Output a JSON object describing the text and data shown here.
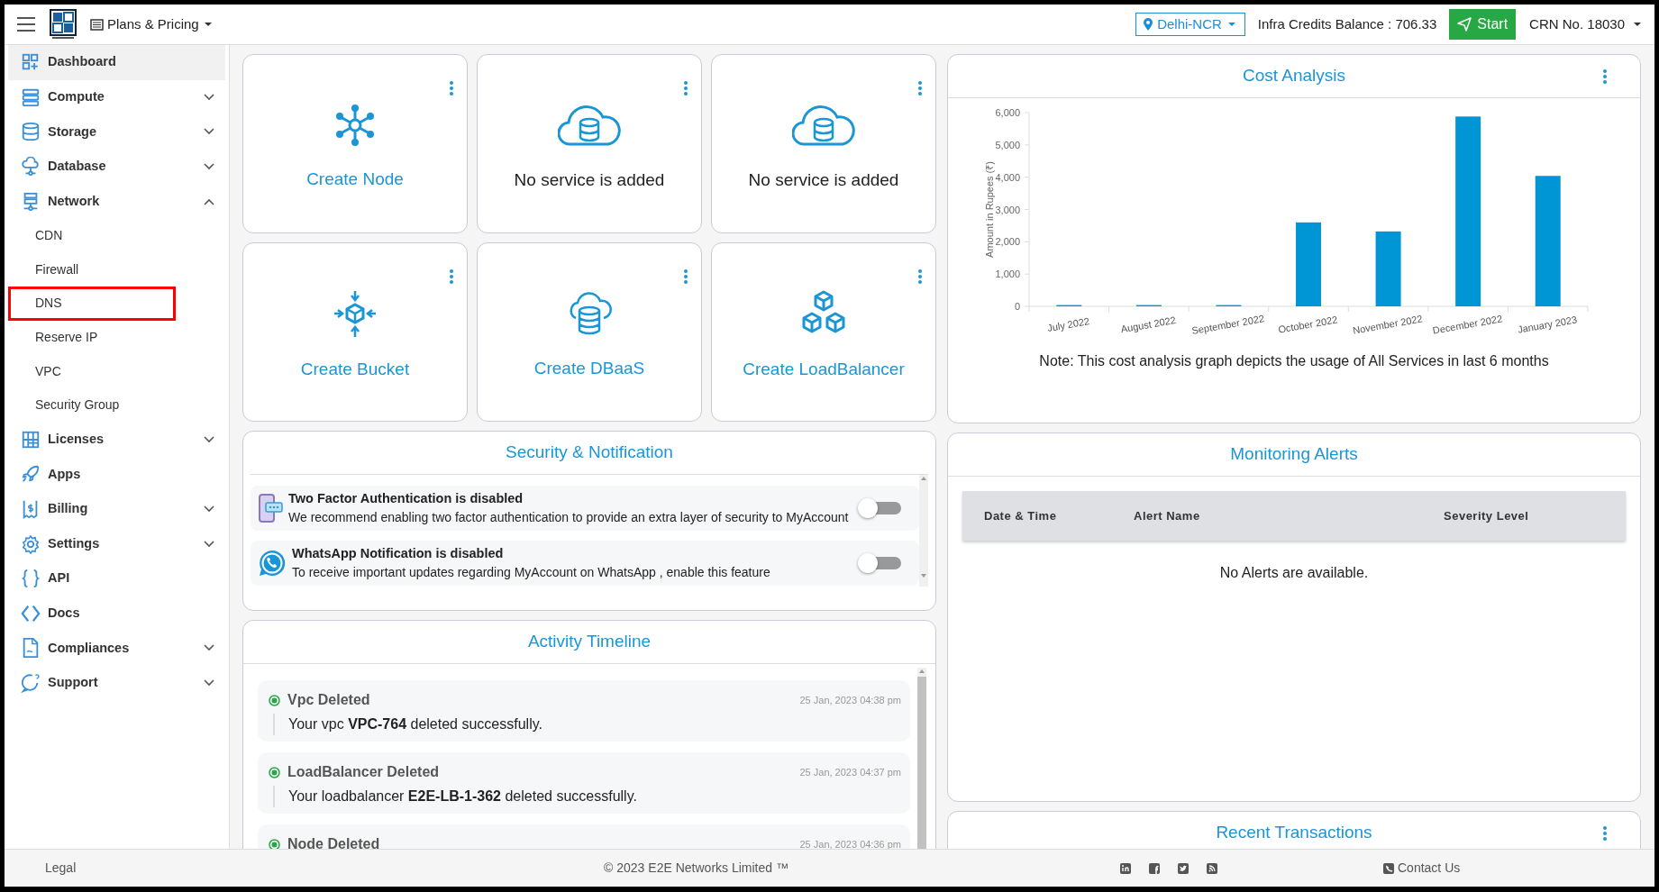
{
  "topbar": {
    "menu": "Plans & Pricing",
    "region": "Delhi-NCR",
    "credits": "Infra Credits Balance : 706.33",
    "start_button": "Start",
    "crn": "CRN No. 18030"
  },
  "sidebar": {
    "items": [
      {
        "label": "Dashboard",
        "selected": true
      },
      {
        "label": "Compute",
        "selected": false,
        "expanded": false
      },
      {
        "label": "Storage",
        "selected": false,
        "expanded": false
      },
      {
        "label": "Database",
        "selected": false,
        "expanded": false
      },
      {
        "label": "Network",
        "selected": false,
        "expanded": true,
        "children": [
          {
            "label": "CDN",
            "highlighted": false
          },
          {
            "label": "Firewall",
            "highlighted": false
          },
          {
            "label": "DNS",
            "highlighted": true
          },
          {
            "label": "Reserve IP",
            "highlighted": false
          },
          {
            "label": "VPC",
            "highlighted": false
          },
          {
            "label": "Security Group",
            "highlighted": false
          }
        ]
      },
      {
        "label": "Licenses",
        "selected": false,
        "expanded": false
      },
      {
        "label": "Apps",
        "selected": false
      },
      {
        "label": "Billing",
        "selected": false,
        "expanded": false
      },
      {
        "label": "Settings",
        "selected": false,
        "expanded": false
      },
      {
        "label": "API",
        "selected": false
      },
      {
        "label": "Docs",
        "selected": false
      },
      {
        "label": "Compliances",
        "selected": false,
        "expanded": false
      },
      {
        "label": "Support",
        "selected": false,
        "expanded": false
      }
    ]
  },
  "service_tiles": [
    {
      "text": "Create Node",
      "kind": "action"
    },
    {
      "text": "No service is added",
      "kind": "empty"
    },
    {
      "text": "No service is added",
      "kind": "empty"
    },
    {
      "text": "Create Bucket",
      "kind": "action"
    },
    {
      "text": "Create DBaaS",
      "kind": "action"
    },
    {
      "text": "Create LoadBalancer",
      "kind": "action"
    }
  ],
  "cost_analysis": {
    "title": "Cost Analysis",
    "chart_data": {
      "type": "bar",
      "ylabel": "Amount in Rupees (₹)",
      "categories": [
        "July 2022",
        "August 2022",
        "September 2022",
        "October 2022",
        "November 2022",
        "December 2022",
        "January 2023"
      ],
      "values": [
        40,
        40,
        40,
        2600,
        2320,
        5880,
        4040
      ],
      "ylim": [
        0,
        6000
      ],
      "yticks": [
        {
          "value": 0,
          "label": "0"
        },
        {
          "value": 1000,
          "label": "1,000"
        },
        {
          "value": 2000,
          "label": "2,000"
        },
        {
          "value": 3000,
          "label": "3,000"
        },
        {
          "value": 4000,
          "label": "4,000"
        },
        {
          "value": 5000,
          "label": "5,000"
        },
        {
          "value": 6000,
          "label": "6,000"
        }
      ]
    },
    "note": "Note: This cost analysis graph depicts the usage of All Services in last 6 months"
  },
  "security": {
    "title": "Security & Notification",
    "items": [
      {
        "title": "Two Factor Authentication is disabled",
        "text": "We recommend enabling two factor authentication to provide an extra layer of security to MyAccount",
        "on": false
      },
      {
        "title": "WhatsApp Notification is disabled",
        "text": "To receive important updates regarding MyAccount on WhatsApp , enable this feature",
        "on": false
      }
    ]
  },
  "monitoring": {
    "title": "Monitoring Alerts",
    "columns": [
      "Date & Time",
      "Alert Name",
      "Severity Level"
    ],
    "empty": "No Alerts are available."
  },
  "activity": {
    "title": "Activity Timeline",
    "items": [
      {
        "title": "Vpc Deleted",
        "time": "25 Jan, 2023 04:38 pm",
        "message": "Your vpc **VPC-764** deleted successfully."
      },
      {
        "title": "LoadBalancer Deleted",
        "time": "25 Jan, 2023 04:37 pm",
        "message": "Your loadbalancer **E2E-LB-1-362** deleted successfully."
      },
      {
        "title": "Node Deleted",
        "time": "25 Jan, 2023 04:36 pm"
      }
    ]
  },
  "recent_transactions": {
    "title": "Recent Transactions"
  },
  "footer": {
    "legal": "Legal",
    "copyright": "© 2023",
    "company": "E2E Networks Limited ™",
    "contact": "Contact Us"
  }
}
